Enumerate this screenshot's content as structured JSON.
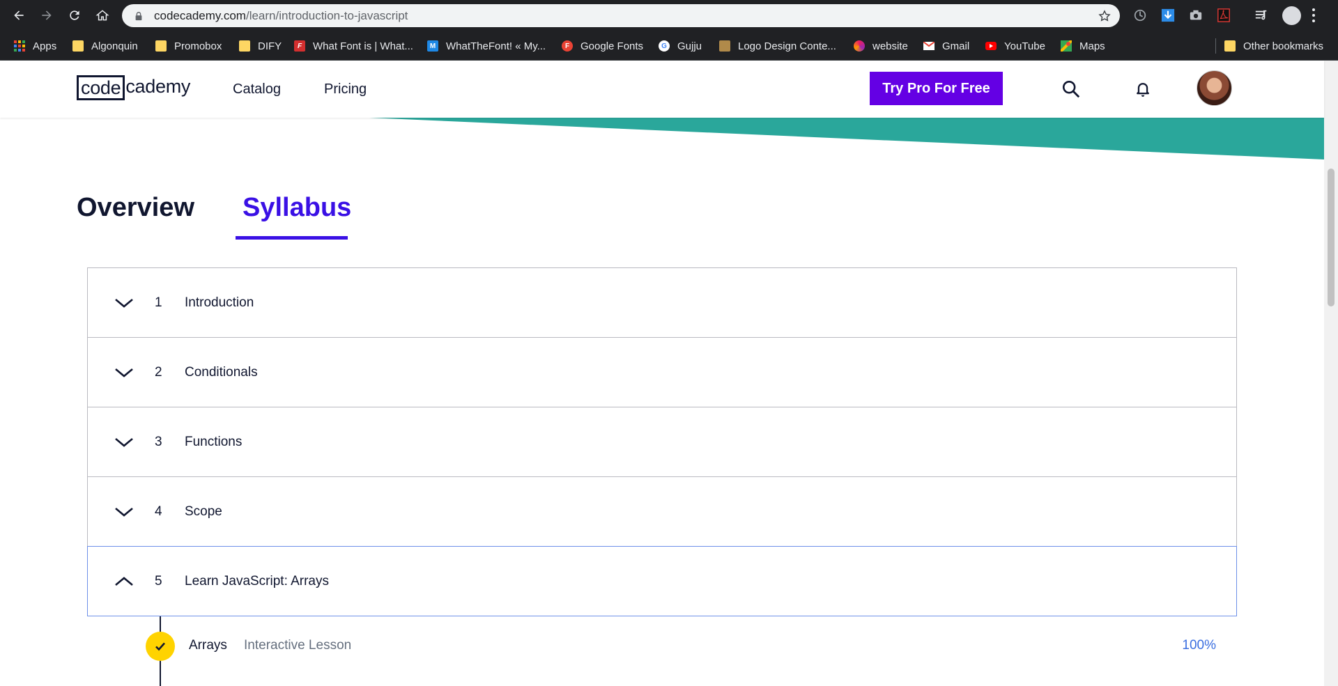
{
  "browser": {
    "url_host": "codecademy.com",
    "url_path": "/learn/introduction-to-javascript",
    "bookmarks": [
      {
        "label": "Apps",
        "icon": "apps-grid-icon"
      },
      {
        "label": "Algonquin",
        "icon": "folder-icon"
      },
      {
        "label": "Promobox",
        "icon": "folder-icon"
      },
      {
        "label": "DIFY",
        "icon": "folder-icon"
      },
      {
        "label": "What Font is | What...",
        "icon": "whatfontis-icon"
      },
      {
        "label": "WhatTheFont! « My...",
        "icon": "whatthefont-icon"
      },
      {
        "label": "Google Fonts",
        "icon": "google-fonts-icon"
      },
      {
        "label": "Gujju",
        "icon": "google-icon"
      },
      {
        "label": "Logo Design Conte...",
        "icon": "logo-design-icon"
      },
      {
        "label": "website",
        "icon": "website-icon"
      },
      {
        "label": "Gmail",
        "icon": "gmail-icon"
      },
      {
        "label": "YouTube",
        "icon": "youtube-icon"
      },
      {
        "label": "Maps",
        "icon": "maps-icon"
      },
      {
        "label": "Other bookmarks",
        "icon": "folder-icon"
      }
    ]
  },
  "header": {
    "logo_code": "code",
    "logo_rest": "cademy",
    "nav": [
      "Catalog",
      "Pricing"
    ],
    "cta_label": "Try Pro For Free"
  },
  "tabs": {
    "overview": "Overview",
    "syllabus": "Syllabus"
  },
  "syllabus": {
    "modules": [
      {
        "num": "1",
        "title": "Introduction"
      },
      {
        "num": "2",
        "title": "Conditionals"
      },
      {
        "num": "3",
        "title": "Functions"
      },
      {
        "num": "4",
        "title": "Scope"
      },
      {
        "num": "5",
        "title": "Learn JavaScript: Arrays"
      }
    ],
    "lesson": {
      "title": "Arrays",
      "type": "Interactive Lesson",
      "progress": "100%"
    }
  },
  "colors": {
    "brand_purple": "#6400e4",
    "tab_active": "#3a10e5",
    "teal": "#2aa79b",
    "check_yellow": "#ffd300",
    "progress_blue": "#3a6ee0"
  }
}
